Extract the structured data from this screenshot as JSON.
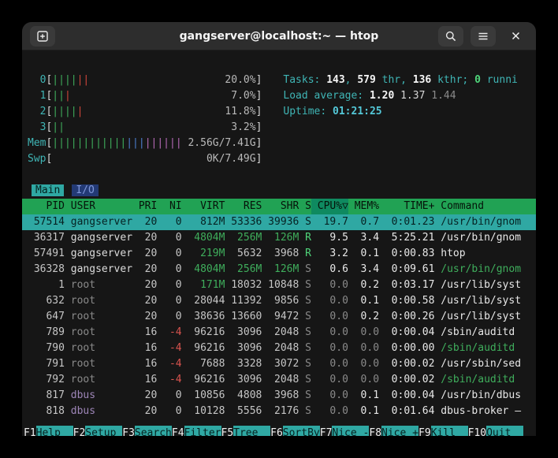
{
  "palette": {
    "accent_cyan": "#2fa8a3",
    "header_green": "#21a254",
    "sort_column_green": "#0f8a60",
    "terminal_bg": "#161616",
    "titlebar_bg": "#2d2d2d",
    "label_cyan": "#3fb5b5",
    "value_green": "#3fae5c",
    "nice_red": "#d9544f"
  },
  "titlebar": {
    "title": "gangserver@localhost:~ — htop",
    "icons": [
      "new-tab-icon",
      "search-icon",
      "menu-icon",
      "close-icon"
    ],
    "close_glyph": "✕"
  },
  "meters": {
    "cpus": [
      {
        "label": "0",
        "value": "20.0%",
        "segments": [
          {
            "color": "green",
            "bars": "||||"
          },
          {
            "color": "red",
            "bars": "||"
          }
        ]
      },
      {
        "label": "1",
        "value": "7.0%",
        "segments": [
          {
            "color": "green",
            "bars": "||"
          },
          {
            "color": "red",
            "bars": "|"
          }
        ]
      },
      {
        "label": "2",
        "value": "11.8%",
        "segments": [
          {
            "color": "green",
            "bars": "||||"
          },
          {
            "color": "red",
            "bars": "|"
          }
        ]
      },
      {
        "label": "3",
        "value": "3.2%",
        "segments": [
          {
            "color": "green",
            "bars": "||"
          }
        ]
      }
    ],
    "mem": {
      "label": "Mem",
      "value": "2.56G/7.41G",
      "segments": [
        {
          "color": "green",
          "bars": "||||||||||||"
        },
        {
          "color": "blue",
          "bars": "|||"
        },
        {
          "color": "magenta",
          "bars": "||||||"
        }
      ]
    },
    "swp": {
      "label": "Swp",
      "value": "0K/7.49G",
      "segments": []
    }
  },
  "stats": {
    "tasks": [
      {
        "t": "Tasks: ",
        "c": "cyan"
      },
      {
        "t": "143",
        "c": "bwhite"
      },
      {
        "t": ", ",
        "c": "cyan"
      },
      {
        "t": "579",
        "c": "bwhite"
      },
      {
        "t": " thr, ",
        "c": "cyan"
      },
      {
        "t": "136",
        "c": "bwhite"
      },
      {
        "t": " kthr; ",
        "c": "cyan"
      },
      {
        "t": "0",
        "c": "bgreen"
      },
      {
        "t": " runni",
        "c": "cyan"
      }
    ],
    "load": [
      {
        "t": "Load average: ",
        "c": "cyan"
      },
      {
        "t": "1.20",
        "c": "bwhite"
      },
      {
        "t": " 1.37",
        "c": "white"
      },
      {
        "t": " 1.44",
        "c": "dim"
      }
    ],
    "uptime": [
      {
        "t": "Uptime: ",
        "c": "cyan"
      },
      {
        "t": "01:21:25",
        "c": "bcyan"
      }
    ]
  },
  "tabs": [
    {
      "label": "Main",
      "active": true
    },
    {
      "label": "I/O",
      "active": false
    }
  ],
  "table": {
    "columns": [
      "PID",
      "USER",
      "PRI",
      "NI",
      "VIRT",
      "RES",
      "SHR",
      "S",
      "CPU%▽",
      "MEM%",
      "TIME+",
      "Command"
    ],
    "sort_column": "CPU%▽",
    "rows": [
      {
        "pid": "57514",
        "user": "gangserver",
        "pri": "20",
        "ni": "0",
        "virt": "812M",
        "res": "53336",
        "shr": "39936",
        "s": "S",
        "cpu": "19.7",
        "mem": "0.7",
        "time": "0:01.23",
        "cmd": "/usr/bin/gnom",
        "selected": true,
        "user_c": "normal",
        "thread": false
      },
      {
        "pid": "36317",
        "user": "gangserver",
        "pri": "20",
        "ni": "0",
        "virt": "4804M",
        "res": "256M",
        "shr": "126M",
        "s": "R",
        "cpu": "9.5",
        "mem": "3.4",
        "time": "5:25.21",
        "cmd": "/usr/bin/gnom",
        "selected": false,
        "user_c": "normal",
        "thread": false
      },
      {
        "pid": "57491",
        "user": "gangserver",
        "pri": "20",
        "ni": "0",
        "virt": "219M",
        "res": "5632",
        "shr": "3968",
        "s": "R",
        "cpu": "3.2",
        "mem": "0.1",
        "time": "0:00.83",
        "cmd": "htop",
        "selected": false,
        "user_c": "normal",
        "thread": false
      },
      {
        "pid": "36328",
        "user": "gangserver",
        "pri": "20",
        "ni": "0",
        "virt": "4804M",
        "res": "256M",
        "shr": "126M",
        "s": "S",
        "cpu": "0.6",
        "mem": "3.4",
        "time": "0:09.61",
        "cmd": "/usr/bin/gnom",
        "selected": false,
        "user_c": "normal",
        "thread": true
      },
      {
        "pid": "1",
        "user": "root",
        "pri": "20",
        "ni": "0",
        "virt": "171M",
        "res": "18032",
        "shr": "10848",
        "s": "S",
        "cpu": "0.0",
        "mem": "0.2",
        "time": "0:03.17",
        "cmd": "/usr/lib/syst",
        "selected": false,
        "user_c": "dim",
        "thread": false
      },
      {
        "pid": "632",
        "user": "root",
        "pri": "20",
        "ni": "0",
        "virt": "28044",
        "res": "11392",
        "shr": "9856",
        "s": "S",
        "cpu": "0.0",
        "mem": "0.1",
        "time": "0:00.58",
        "cmd": "/usr/lib/syst",
        "selected": false,
        "user_c": "dim",
        "thread": false
      },
      {
        "pid": "647",
        "user": "root",
        "pri": "20",
        "ni": "0",
        "virt": "38636",
        "res": "13660",
        "shr": "9472",
        "s": "S",
        "cpu": "0.0",
        "mem": "0.2",
        "time": "0:00.26",
        "cmd": "/usr/lib/syst",
        "selected": false,
        "user_c": "dim",
        "thread": false
      },
      {
        "pid": "789",
        "user": "root",
        "pri": "16",
        "ni": "-4",
        "virt": "96216",
        "res": "3096",
        "shr": "2048",
        "s": "S",
        "cpu": "0.0",
        "mem": "0.0",
        "time": "0:00.04",
        "cmd": "/sbin/auditd",
        "selected": false,
        "user_c": "dim",
        "thread": false
      },
      {
        "pid": "790",
        "user": "root",
        "pri": "16",
        "ni": "-4",
        "virt": "96216",
        "res": "3096",
        "shr": "2048",
        "s": "S",
        "cpu": "0.0",
        "mem": "0.0",
        "time": "0:00.00",
        "cmd": "/sbin/auditd",
        "selected": false,
        "user_c": "dim",
        "thread": true
      },
      {
        "pid": "791",
        "user": "root",
        "pri": "16",
        "ni": "-4",
        "virt": "7688",
        "res": "3328",
        "shr": "3072",
        "s": "S",
        "cpu": "0.0",
        "mem": "0.0",
        "time": "0:00.02",
        "cmd": "/usr/sbin/sed",
        "selected": false,
        "user_c": "dim",
        "thread": false
      },
      {
        "pid": "792",
        "user": "root",
        "pri": "16",
        "ni": "-4",
        "virt": "96216",
        "res": "3096",
        "shr": "2048",
        "s": "S",
        "cpu": "0.0",
        "mem": "0.0",
        "time": "0:00.02",
        "cmd": "/sbin/auditd",
        "selected": false,
        "user_c": "dim",
        "thread": true
      },
      {
        "pid": "817",
        "user": "dbus",
        "pri": "20",
        "ni": "0",
        "virt": "10856",
        "res": "4808",
        "shr": "3968",
        "s": "S",
        "cpu": "0.0",
        "mem": "0.1",
        "time": "0:00.04",
        "cmd": "/usr/bin/dbus",
        "selected": false,
        "user_c": "purple",
        "thread": false
      },
      {
        "pid": "818",
        "user": "dbus",
        "pri": "20",
        "ni": "0",
        "virt": "10128",
        "res": "5556",
        "shr": "2176",
        "s": "S",
        "cpu": "0.0",
        "mem": "0.1",
        "time": "0:01.64",
        "cmd": "dbus-broker –",
        "selected": false,
        "user_c": "purple",
        "thread": false
      }
    ]
  },
  "fnkeys": [
    {
      "key": "F1",
      "label": "Help  "
    },
    {
      "key": "F2",
      "label": "Setup "
    },
    {
      "key": "F3",
      "label": "Search"
    },
    {
      "key": "F4",
      "label": "Filter"
    },
    {
      "key": "F5",
      "label": "Tree  "
    },
    {
      "key": "F6",
      "label": "SortBy"
    },
    {
      "key": "F7",
      "label": "Nice -"
    },
    {
      "key": "F8",
      "label": "Nice +"
    },
    {
      "key": "F9",
      "label": "Kill  "
    },
    {
      "key": "F10",
      "label": "Quit  "
    }
  ]
}
